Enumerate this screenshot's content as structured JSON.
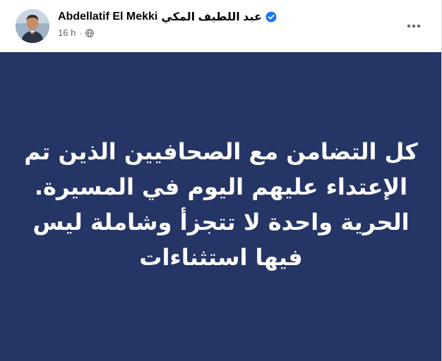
{
  "post": {
    "author_name": "Abdellatif El Mekki",
    "author_name_ar": "عبد اللطيف المكي",
    "timestamp": "16 h",
    "separator": "·",
    "text": "كل التضامن مع الصحافيين الذين تم الإعتداء عليهم اليوم في المسيرة. الحرية واحدة لا تتجزأ وشاملة ليس فيها استثناءات"
  },
  "icons": {
    "verified": "verified-badge-icon",
    "audience": "globe-icon",
    "more": "more-options-icon"
  },
  "colors": {
    "card_background": "#253565",
    "verified_blue": "#1877f2",
    "text_primary": "#050505",
    "text_secondary": "#65676b"
  }
}
